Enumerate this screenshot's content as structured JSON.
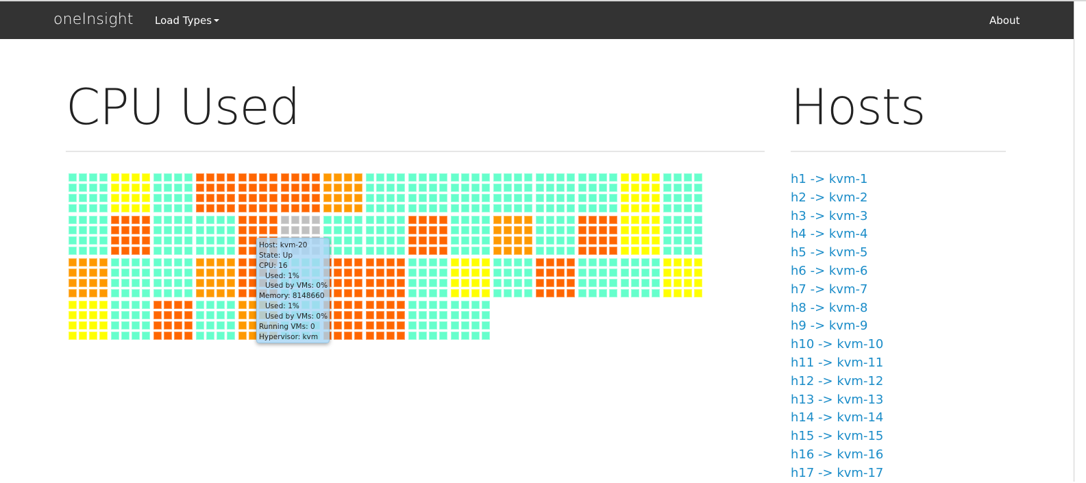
{
  "navbar": {
    "brand": "oneInsight",
    "dropdown_label": "Load Types",
    "about_label": "About"
  },
  "main": {
    "title": "CPU Used",
    "colors": {
      "low": "#66FFCC",
      "medium": "#FFFF00",
      "high": "#FF9900",
      "very_high": "#FF6600",
      "unknown": "#C0C0C0"
    },
    "cpu_per_host": 16,
    "hosts_grid": [
      [
        "low",
        "medium",
        "low",
        "very_high",
        "very_high",
        "very_high",
        "high",
        "low",
        "low",
        "low",
        "low",
        "low",
        "low",
        "medium",
        "low"
      ],
      [
        "low",
        "very_high",
        "low",
        "low",
        "very_high",
        "unknown",
        "low",
        "low",
        "very_high",
        "low",
        "high",
        "low",
        "very_high",
        "medium",
        "low"
      ],
      [
        "high",
        "low",
        "low",
        "high",
        "very_high",
        "low",
        "very_high",
        "very_high",
        "low",
        "medium",
        "low",
        "very_high",
        "low",
        "low",
        "medium"
      ],
      [
        "medium",
        "low",
        "very_high",
        "low",
        "high",
        "low",
        "very_high",
        "very_high",
        "low",
        "low"
      ]
    ]
  },
  "tooltip": {
    "host": "Host: kvm-20",
    "state": "State: Up",
    "cpu": "CPU: 16",
    "cpu_used": "Used: 1%",
    "cpu_used_vms": "Used by VMs: 0%",
    "memory": "Memory: 8148660",
    "mem_used": "Used: 1%",
    "mem_used_vms": "Used by VMs: 0%",
    "running_vms": "Running VMs: 0",
    "hypervisor": "Hypervisor: kvm"
  },
  "sidebar": {
    "title": "Hosts",
    "hosts": [
      "h1 -> kvm-1",
      "h2 -> kvm-2",
      "h3 -> kvm-3",
      "h4 -> kvm-4",
      "h5 -> kvm-5",
      "h6 -> kvm-6",
      "h7 -> kvm-7",
      "h8 -> kvm-8",
      "h9 -> kvm-9",
      "h10 -> kvm-10",
      "h11 -> kvm-11",
      "h12 -> kvm-12",
      "h13 -> kvm-13",
      "h14 -> kvm-14",
      "h15 -> kvm-15",
      "h16 -> kvm-16",
      "h17 -> kvm-17"
    ]
  }
}
